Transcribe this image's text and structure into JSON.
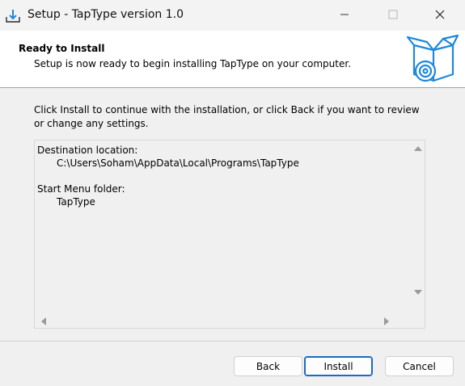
{
  "window": {
    "title": "Setup - TapType version 1.0"
  },
  "header": {
    "title": "Ready to Install",
    "subtitle": "Setup is now ready to begin installing TapType on your computer."
  },
  "main": {
    "instructions": "Click Install to continue with the installation, or click Back if you want to review or change any settings.",
    "memo": {
      "dest_label": "Destination location:",
      "dest_value": "C:\\Users\\Soham\\AppData\\Local\\Programs\\TapType",
      "menu_label": "Start Menu folder:",
      "menu_value": "TapType"
    }
  },
  "buttons": {
    "back": "Back",
    "install": "Install",
    "cancel": "Cancel"
  },
  "icons": {
    "app": "installer-download-icon",
    "header": "software-box-disc-icon",
    "minimize": "minimize-icon",
    "maximize": "maximize-icon",
    "close": "close-icon"
  },
  "colors": {
    "accent": "#1b6ac9",
    "icon_blue": "#1e88d9"
  }
}
